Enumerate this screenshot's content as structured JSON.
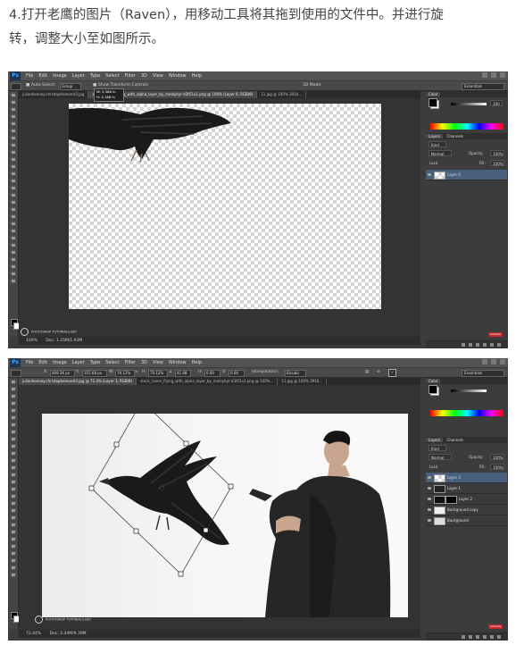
{
  "caption": {
    "line1": "4.打开老鹰的图片（Raven），用移动工具将其拖到使用的文件中。并进行旋",
    "line2": "转，调整大小至如图所示。"
  },
  "app": {
    "logo": "Ps",
    "menus": [
      "File",
      "Edit",
      "Image",
      "Layer",
      "Type",
      "Select",
      "Filter",
      "3D",
      "View",
      "Window",
      "Help"
    ]
  },
  "shot1": {
    "options": {
      "auto_select_label": "Auto-Select:",
      "auto_select_value": "Group",
      "show_transform_label": "Show Transform Controls",
      "tooltip_w": "W: 3.388 in",
      "tooltip_h": "H: 4.168 in",
      "mode_3d": "3D Mode:",
      "workspace": "Essentials"
    },
    "tabs": [
      "julianheeney.christophemoret3.jpg",
      "stock_raven_flying_with_alpha_layer_by_meloyhyr-d3t51u1.png @ 100% (Layer 0, RGB/8)",
      "11.jpg @ 100% 3916..."
    ],
    "status": {
      "zoom": "100%",
      "doc": "Doc: 1.25M/1.93M"
    },
    "layers": [
      {
        "name": "Layer 0",
        "selected": true
      }
    ],
    "panel": {
      "color_tab": "Color",
      "value": "100",
      "layers_tab": "Layers",
      "channels_tab": "Channels",
      "kind": "Kind",
      "blend": "Normal",
      "opacity_label": "Opacity:",
      "opacity": "100%",
      "lock_label": "Lock:",
      "fill_label": "Fill:",
      "fill": "100%"
    },
    "watermark": "PHOTOSHOP TUTORIALS.NET",
    "button": "Activate"
  },
  "shot2": {
    "options": {
      "x_label": "X:",
      "x_value": "469.36 px",
      "y_label": "Y:",
      "y_value": "355.68 px",
      "w_label": "W:",
      "w_value": "79.12%",
      "h_label": "H:",
      "h_value": "79.12%",
      "angle": "41.98",
      "h_skew_label": "H:",
      "h_skew": "0.00",
      "v_skew_label": "V:",
      "v_skew": "0.00",
      "interp_label": "Interpolation:",
      "interp_value": "Bicubic",
      "workspace": "Essentials"
    },
    "tabs": [
      "julianheeney.christophemoret3.jpg @ 72.4% (Layer 3, RGB/8)",
      "stock_raven_flying_with_alpha_layer_by_meloyhyr-d3t51u1.png @ 100%...",
      "11.jpg @ 100% 3916..."
    ],
    "status": {
      "zoom": "72.44%",
      "doc": "Doc: 2.44M/9.39M"
    },
    "layers": [
      {
        "name": "Layer 3",
        "selected": true
      },
      {
        "name": "Layer 1",
        "selected": false
      },
      {
        "name": "Layer 2",
        "selected": false
      },
      {
        "name": "Background copy",
        "selected": false
      },
      {
        "name": "Background",
        "selected": false
      }
    ],
    "panel": {
      "color_tab": "Color",
      "layers_tab": "Layers",
      "channels_tab": "Channels",
      "kind": "Kind",
      "blend": "Normal",
      "opacity_label": "Opacity:",
      "opacity": "100%",
      "lock_label": "Lock:",
      "fill_label": "Fill:",
      "fill": "100%"
    },
    "watermark": "PHOTOSHOP TUTORIALS.NET",
    "button": "Activate"
  }
}
